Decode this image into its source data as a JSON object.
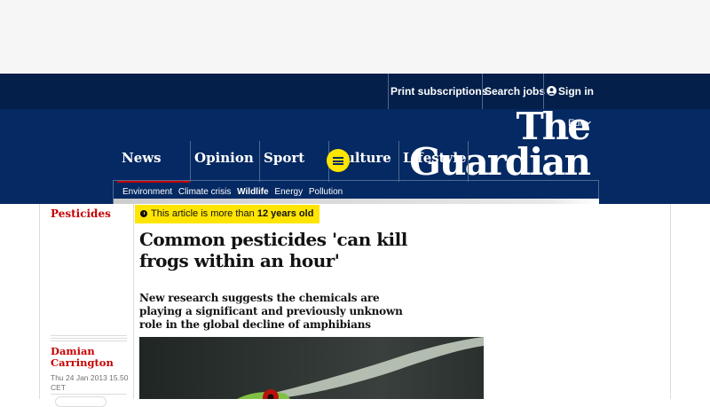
{
  "top_bar": {
    "links": [
      "Print subscriptions",
      "Search jobs",
      "Sign in"
    ]
  },
  "masthead": {
    "logo_line1": "The",
    "logo_line2": "Guardian",
    "edition": "Eur",
    "pillars": [
      "News",
      "Opinion",
      "Sport",
      "Culture",
      "Lifestyle"
    ],
    "active_pillar": "News",
    "subnav": [
      "Environment",
      "Climate crisis",
      "Wildlife",
      "Energy",
      "Pollution"
    ],
    "subnav_bold": "Wildlife"
  },
  "article": {
    "section": "Pesticides",
    "age_prefix": "This article is more than",
    "age_value": "12 years old",
    "headline": "Common pesticides 'can kill frogs within an hour'",
    "standfirst": "New research suggests the chemicals are playing a significant and previously unknown role in the global decline of amphibians",
    "author_line1": "Damian",
    "author_line2": "Carrington",
    "dateline": "Thu 24 Jan 2013 15.50 CET"
  },
  "colors": {
    "brand_blue": "#052962",
    "top_bar": "#041f4a",
    "news_red": "#c70000",
    "highlight_yellow": "#ffe500"
  },
  "icons": [
    "user-icon",
    "chevron-down-icon",
    "menu-icon",
    "clock-icon"
  ]
}
